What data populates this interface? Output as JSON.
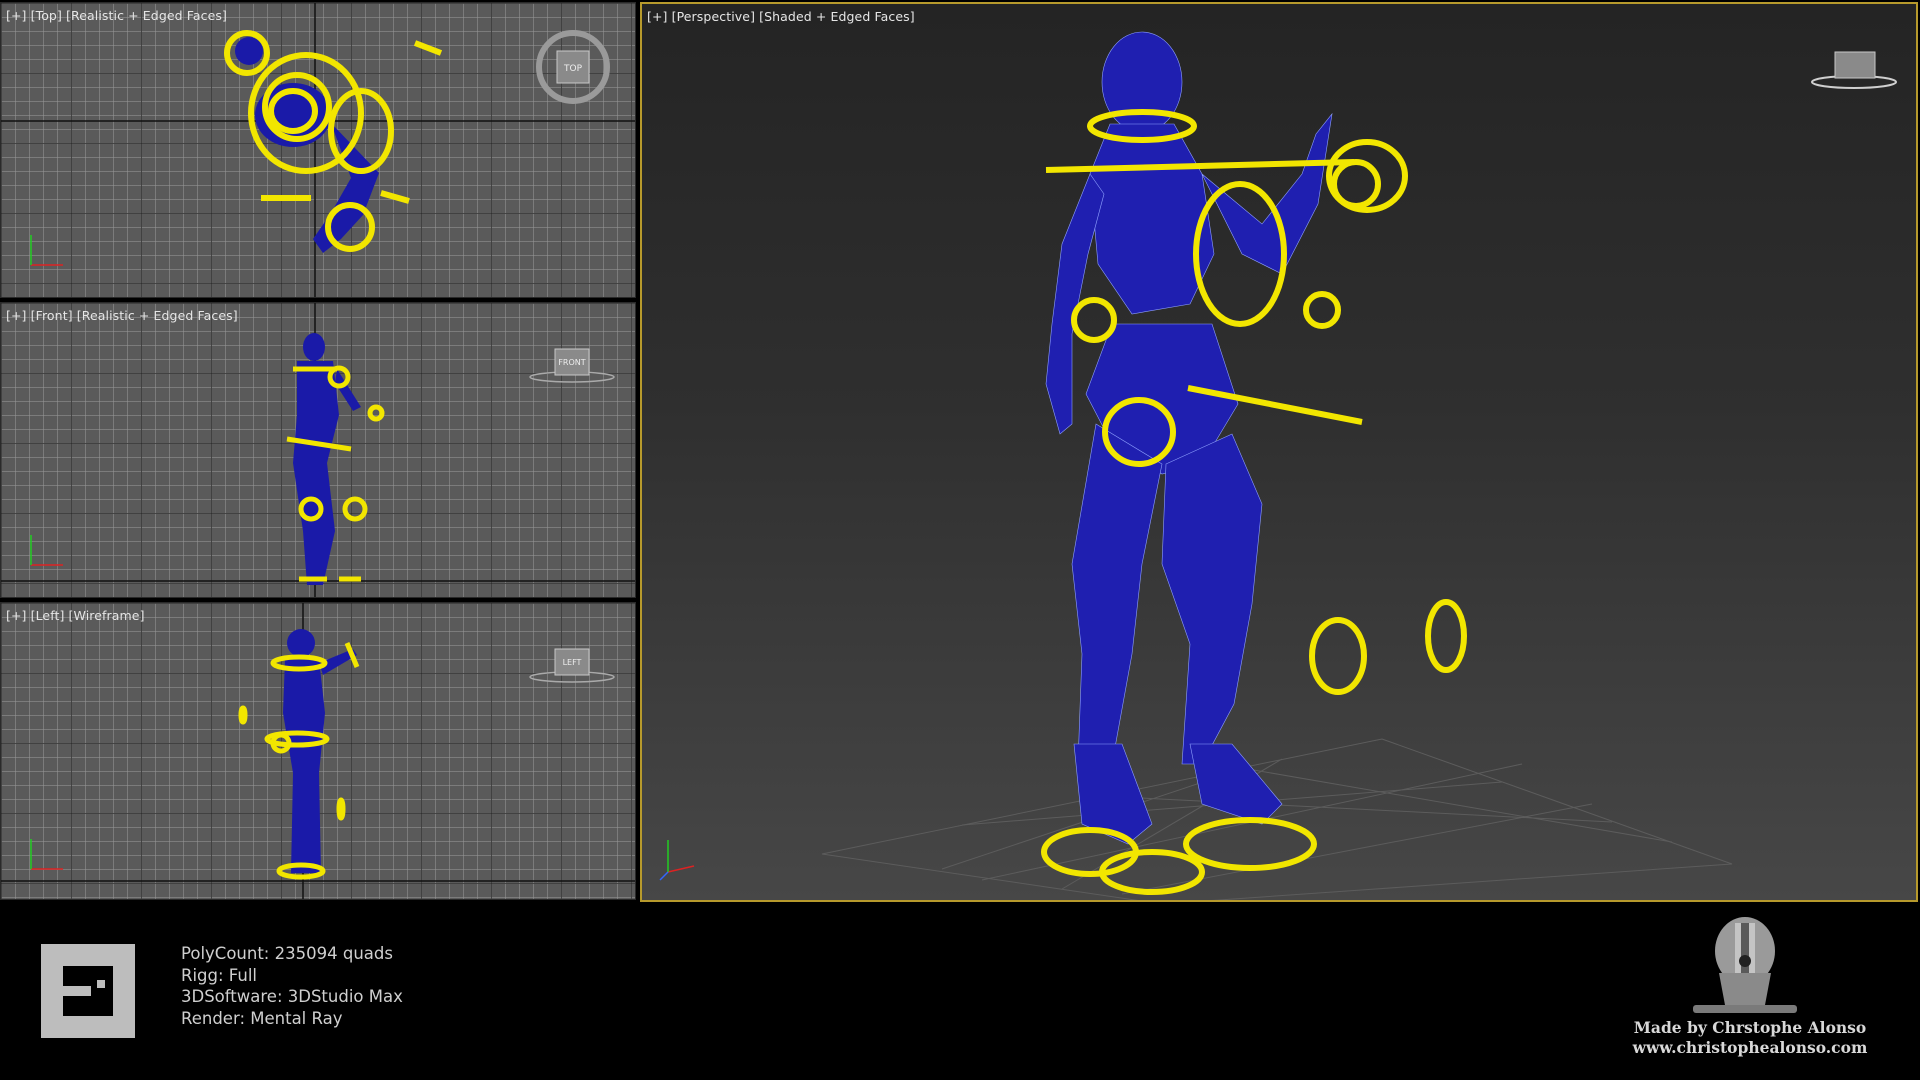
{
  "viewports": {
    "top": {
      "label": "[+] [Top] [Realistic + Edged Faces]",
      "cube": "TOP"
    },
    "front": {
      "label": "[+] [Front] [Realistic + Edged Faces]",
      "cube": "FRONT"
    },
    "left": {
      "label": "[+] [Left] [Wireframe]",
      "cube": "LEFT"
    },
    "perspective": {
      "label": "[+] [Perspective] [Shaded + Edged Faces]"
    }
  },
  "info": {
    "polycount": "PolyCount: 235094 quads",
    "rigg": "Rigg: Full",
    "software": "3DSoftware: 3DStudio Max",
    "render": "Render: Mental Ray"
  },
  "credits": {
    "made_by": "Made by Chrstophe Alonso",
    "website": "www.christophealonso.com"
  },
  "colors": {
    "rig_controls": "#f2e600",
    "mesh": "#1a1aa8",
    "active_viewport_border": "#b79a2c"
  },
  "icons": [
    "axis-tripod-icon",
    "viewcube-icon",
    "compass-ring-icon",
    "logo-icon",
    "robot-head-icon"
  ]
}
